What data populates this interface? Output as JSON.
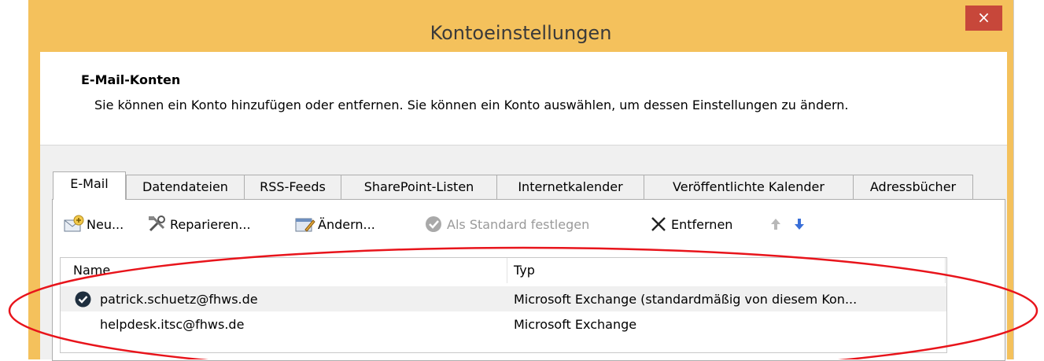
{
  "window": {
    "title": "Kontoeinstellungen",
    "close_label": "×"
  },
  "header": {
    "title": "E-Mail-Konten",
    "description": "Sie können ein Konto hinzufügen oder entfernen. Sie können ein Konto auswählen, um dessen Einstellungen zu ändern."
  },
  "tabs": [
    {
      "label": "E-Mail",
      "active": true
    },
    {
      "label": "Datendateien"
    },
    {
      "label": "RSS-Feeds"
    },
    {
      "label": "SharePoint-Listen"
    },
    {
      "label": "Internetkalender"
    },
    {
      "label": "Veröffentlichte Kalender"
    },
    {
      "label": "Adressbücher"
    }
  ],
  "toolbar": {
    "new_label": "Neu...",
    "repair_label": "Reparieren...",
    "change_label": "Ändern...",
    "default_label": "Als Standard festlegen",
    "remove_label": "Entfernen",
    "move_up_icon": "arrow-up-icon",
    "move_down_icon": "arrow-down-icon"
  },
  "list": {
    "columns": [
      "Name",
      "Typ"
    ],
    "rows": [
      {
        "name": "patrick.schuetz@fhws.de",
        "type": "Microsoft Exchange (standardmäßig von diesem Kon...",
        "selected": true
      },
      {
        "name": "helpdesk.itsc@fhws.de",
        "type": "Microsoft Exchange"
      }
    ]
  },
  "colors": {
    "window_frame": "#f4c15c",
    "close_button": "#c7473a",
    "annotation_ellipse": "#e8141b",
    "selection": "#f0f0f0"
  }
}
